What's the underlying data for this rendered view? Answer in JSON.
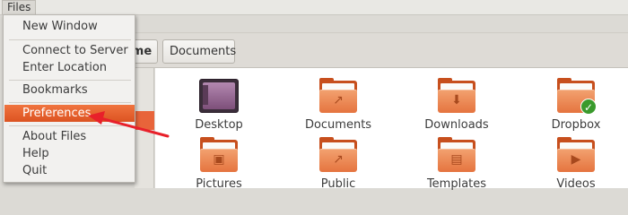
{
  "menubar": {
    "files_label": "Files"
  },
  "breadcrumb": {
    "home": "Home",
    "current": "Documents"
  },
  "menu": {
    "items": [
      {
        "label": "New Window"
      },
      {
        "label": "Connect to Server"
      },
      {
        "label": "Enter Location"
      },
      {
        "label": "Bookmarks"
      },
      {
        "label": "Preferences",
        "highlighted": true
      },
      {
        "label": "About Files"
      },
      {
        "label": "Help"
      },
      {
        "label": "Quit"
      }
    ]
  },
  "folders": [
    {
      "label": "Desktop",
      "icon": "desktop-icon"
    },
    {
      "label": "Documents",
      "icon": "documents-folder-icon"
    },
    {
      "label": "Downloads",
      "icon": "downloads-folder-icon"
    },
    {
      "label": "Dropbox",
      "icon": "dropbox-folder-icon"
    },
    {
      "label": "Pictures",
      "icon": "pictures-folder-icon"
    },
    {
      "label": "Public",
      "icon": "public-folder-icon"
    },
    {
      "label": "Templates",
      "icon": "templates-folder-icon"
    },
    {
      "label": "Videos",
      "icon": "videos-folder-icon"
    }
  ],
  "colors": {
    "accent": "#e8643a",
    "folder": "#e5743f",
    "arrow": "#e8202a"
  }
}
